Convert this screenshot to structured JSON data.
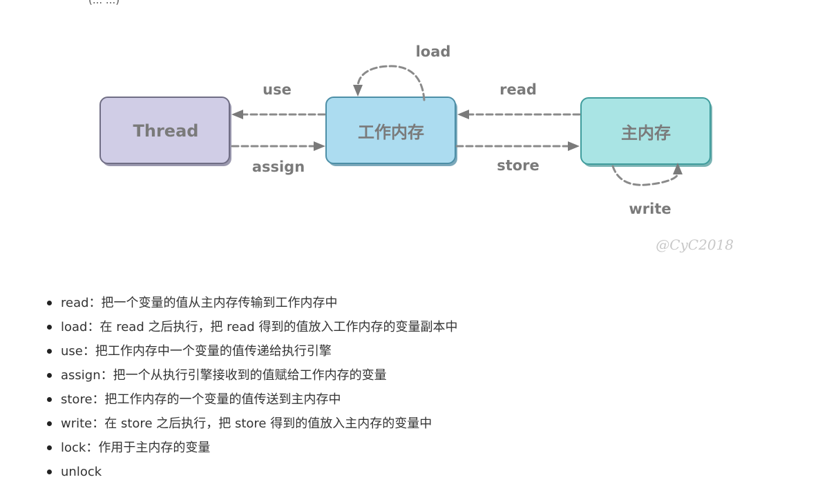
{
  "header_fragment": "(... ...)",
  "diagram": {
    "nodes": {
      "thread": "Thread",
      "working_memory": "工作内存",
      "main_memory": "主内存"
    },
    "edges": {
      "use": "use",
      "assign": "assign",
      "load": "load",
      "read": "read",
      "store": "store",
      "write": "write"
    },
    "watermark": "@CyC2018",
    "colors": {
      "thread_fill": "#d0cde6",
      "working_memory_fill": "#acdcf0",
      "main_memory_fill": "#a9e4e4",
      "arrow": "#8a8a8a",
      "label": "#7a7a7a"
    }
  },
  "operations": [
    {
      "name": "read",
      "desc": "：把一个变量的值从主内存传输到工作内存中"
    },
    {
      "name": "load",
      "desc": "：在 read 之后执行，把 read 得到的值放入工作内存的变量副本中"
    },
    {
      "name": "use",
      "desc": "：把工作内存中一个变量的值传递给执行引擎"
    },
    {
      "name": "assign",
      "desc": "：把一个从执行引擎接收到的值赋给工作内存的变量"
    },
    {
      "name": "store",
      "desc": "：把工作内存的一个变量的值传送到主内存中"
    },
    {
      "name": "write",
      "desc": "：在 store 之后执行，把 store 得到的值放入主内存的变量中"
    },
    {
      "name": "lock",
      "desc": "：作用于主内存的变量"
    },
    {
      "name": "unlock",
      "desc": ""
    }
  ]
}
